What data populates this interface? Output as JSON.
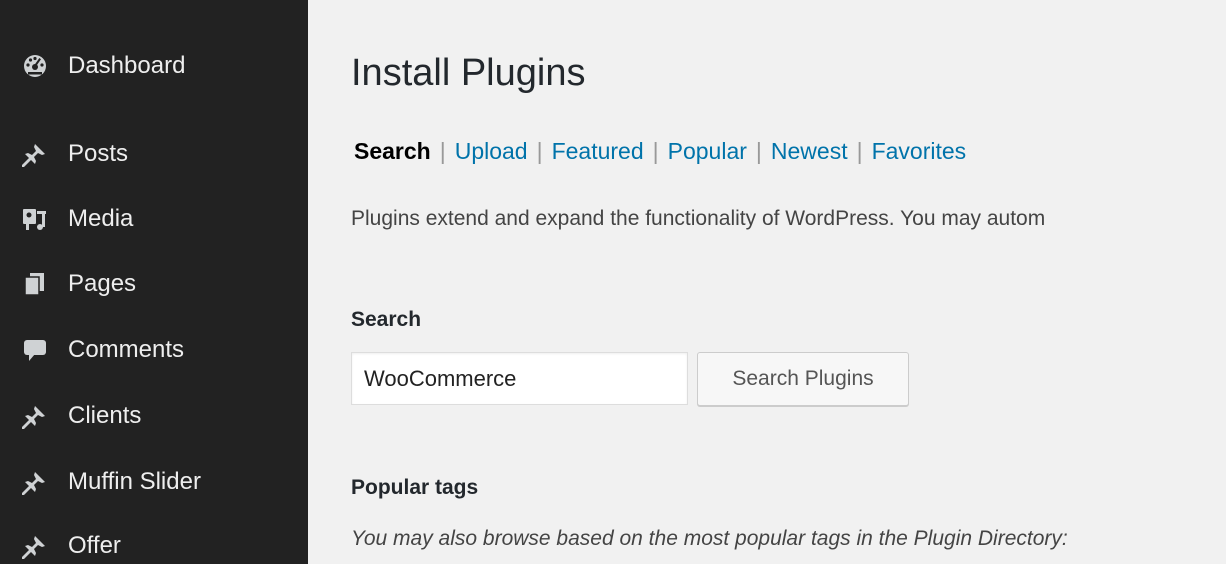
{
  "sidebar": {
    "items": [
      {
        "label": "Dashboard",
        "icon": "dashboard-icon"
      },
      {
        "label": "Posts",
        "icon": "pin-icon"
      },
      {
        "label": "Media",
        "icon": "media-icon"
      },
      {
        "label": "Pages",
        "icon": "pages-icon"
      },
      {
        "label": "Comments",
        "icon": "comment-icon"
      },
      {
        "label": "Clients",
        "icon": "pin-icon"
      },
      {
        "label": "Muffin Slider",
        "icon": "pin-icon"
      },
      {
        "label": "Offer",
        "icon": "pin-icon"
      }
    ]
  },
  "main": {
    "title": "Install Plugins",
    "subnav": {
      "current": "Search",
      "links": [
        "Upload",
        "Featured",
        "Popular",
        "Newest",
        "Favorites"
      ],
      "separator": "|"
    },
    "intro": "Plugins extend and expand the functionality of WordPress. You may autom",
    "search": {
      "heading": "Search",
      "input_value": "WooCommerce",
      "button_label": "Search Plugins"
    },
    "popular": {
      "heading": "Popular tags",
      "description": "You may also browse based on the most popular tags in the Plugin Directory:"
    }
  },
  "colors": {
    "sidebar_bg": "#222222",
    "content_bg": "#f1f1f1",
    "link": "#0073aa",
    "icon": "#9ea3a8"
  }
}
